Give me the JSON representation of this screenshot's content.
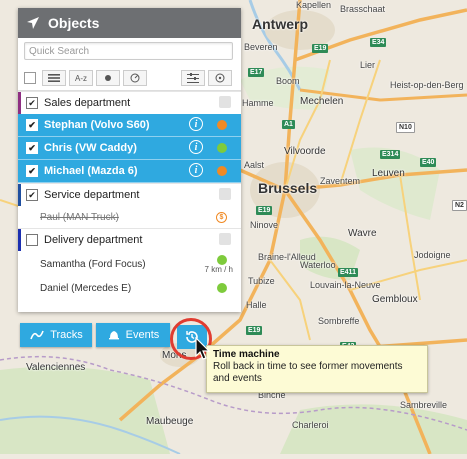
{
  "map": {
    "cities": [
      {
        "name": "Antwerp",
        "size": "big"
      },
      {
        "name": "Brussels",
        "size": "big"
      },
      {
        "name": "Mons",
        "size": "mid"
      },
      {
        "name": "Leuven",
        "size": "mid"
      },
      {
        "name": "Mechelen",
        "size": "mid"
      },
      {
        "name": "Vilvoorde",
        "size": "mid"
      },
      {
        "name": "Gembloux",
        "size": "mid"
      },
      {
        "name": "Valenciennes",
        "size": "mid"
      },
      {
        "name": "Maubeuge",
        "size": "mid"
      },
      {
        "name": "Wavre",
        "size": "mid"
      },
      {
        "name": "Zaventem",
        "size": "sm"
      },
      {
        "name": "Waterloo",
        "size": "sm"
      },
      {
        "name": "Braine-l'Alleud",
        "size": "sm"
      },
      {
        "name": "Lier",
        "size": "sm"
      },
      {
        "name": "Aalst",
        "size": "sm"
      },
      {
        "name": "Ninove",
        "size": "sm"
      },
      {
        "name": "Hamme",
        "size": "sm"
      },
      {
        "name": "Boom",
        "size": "sm"
      },
      {
        "name": "Sombreffe",
        "size": "sm"
      },
      {
        "name": "Binche",
        "size": "sm"
      },
      {
        "name": "Jodoigne",
        "size": "sm"
      },
      {
        "name": "Louvain-la-Neuve",
        "size": "sm"
      },
      {
        "name": "Charleroi",
        "size": "sm"
      },
      {
        "name": "Tubize",
        "size": "sm"
      },
      {
        "name": "Sambreville",
        "size": "sm"
      },
      {
        "name": "Halle",
        "size": "sm"
      },
      {
        "name": "Heist-op-den-Berg",
        "size": "sm"
      },
      {
        "name": "Beveren",
        "size": "sm"
      },
      {
        "name": "Kapellen",
        "size": "sm"
      },
      {
        "name": "Brasschaat",
        "size": "sm"
      }
    ],
    "routes": [
      "E19",
      "E34",
      "E17",
      "E40",
      "E411",
      "E42",
      "N10",
      "E314",
      "A1",
      "E19",
      "N2",
      "E19"
    ]
  },
  "panel": {
    "title": "Objects",
    "search_placeholder": "Quick Search",
    "toolbar": {
      "sort_alpha": "A-z"
    },
    "groups": [
      {
        "name": "Sales department",
        "color": "#8e2f82"
      },
      {
        "name": "Service department",
        "color": "#1f4fa0"
      },
      {
        "name": "Delivery department",
        "color": "#1b2fb0"
      }
    ],
    "objects": [
      {
        "name": "Stephan (Volvo S60)",
        "status": "#f08a24",
        "selected": true
      },
      {
        "name": "Chris (VW Caddy)",
        "status": "#7ecb3c",
        "selected": true
      },
      {
        "name": "Michael (Mazda 6)",
        "status": "#f08a24",
        "selected": true
      },
      {
        "name": "Paul (MAN Truck)",
        "status": "#f08a24",
        "selected": false
      },
      {
        "name": "Samantha (Ford Focus)",
        "status": "#7ecb3c",
        "selected": false
      },
      {
        "name": "Daniel (Mercedes E)",
        "status": "#7ecb3c",
        "selected": false
      }
    ],
    "speed": "7 km / h"
  },
  "buttons": {
    "tracks": "Tracks",
    "events": "Events"
  },
  "tooltip": {
    "title": "Time machine",
    "description": "Roll back in time to see former movements and events"
  },
  "colors": {
    "accent": "#2fa9e0",
    "header": "#6d6f72",
    "highlight": "#e03c31"
  }
}
